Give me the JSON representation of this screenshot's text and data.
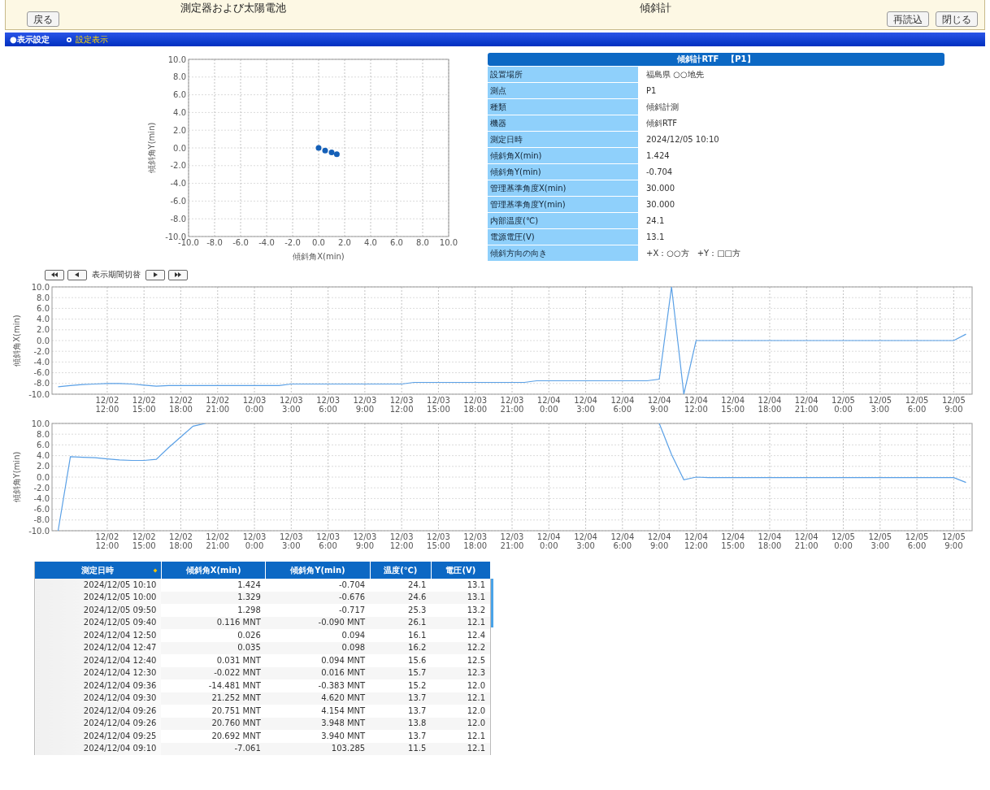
{
  "header": {
    "back_button": "戻る",
    "titles": [
      "測定器および太陽電池",
      "傾斜計"
    ],
    "buttons": [
      "再読込",
      "閉じる"
    ]
  },
  "nav_bar": {
    "section_title": "●表示設定",
    "link": "設定表示"
  },
  "scatter": {
    "chart_data": {
      "type": "scatter",
      "grid": true,
      "xlabel": "傾斜角X(min)",
      "ylabel": "傾斜角Y(min)",
      "xlim": [
        -10,
        10
      ],
      "ylim": [
        -10,
        10
      ],
      "xticks": [
        {
          "value": -10,
          "label": "-10.0"
        },
        {
          "value": -8,
          "label": "-8.0"
        },
        {
          "value": -6,
          "label": "-6.0"
        },
        {
          "value": -4,
          "label": "-4.0"
        },
        {
          "value": -2,
          "label": "-2.0"
        },
        {
          "value": 0,
          "label": "0.0"
        },
        {
          "value": 2,
          "label": "2.0"
        },
        {
          "value": 4,
          "label": "4.0"
        },
        {
          "value": 6,
          "label": "6.0"
        },
        {
          "value": 8,
          "label": "8.0"
        },
        {
          "value": 10,
          "label": "10.0"
        }
      ],
      "yticks": [
        {
          "value": 10,
          "label": "10.0"
        },
        {
          "value": 8,
          "label": "8.0"
        },
        {
          "value": 6,
          "label": "6.0"
        },
        {
          "value": 4,
          "label": "4.0"
        },
        {
          "value": 2,
          "label": "2.0"
        },
        {
          "value": 0,
          "label": "0.0"
        },
        {
          "value": -2,
          "label": "-2.0"
        },
        {
          "value": -4,
          "label": "-4.0"
        },
        {
          "value": -6,
          "label": "-6.0"
        },
        {
          "value": -8,
          "label": "-8.0"
        },
        {
          "value": -10,
          "label": "-10.0"
        }
      ],
      "x": [
        0.0,
        0.5,
        1.0,
        1.4
      ],
      "series": [
        {
          "color": "#1560b8",
          "values": [
            0.0,
            -0.3,
            -0.5,
            -0.7
          ]
        }
      ]
    }
  },
  "info": {
    "title": "傾斜計RTF　【P1】",
    "rows": [
      {
        "label": "設置場所",
        "value": "福島県 ○○地先"
      },
      {
        "label": "測点",
        "value": "P1"
      },
      {
        "label": "種類",
        "value": "傾斜計測"
      },
      {
        "label": "機器",
        "value": "傾斜RTF"
      },
      {
        "label": "測定日時",
        "value": "2024/12/05 10:10"
      },
      {
        "label": "傾斜角X(min)",
        "value": "1.424"
      },
      {
        "label": "傾斜角Y(min)",
        "value": "-0.704"
      },
      {
        "label": "管理基準角度X(min)",
        "value": "30.000"
      },
      {
        "label": "管理基準角度Y(min)",
        "value": "30.000"
      },
      {
        "label": "内部温度(℃)",
        "value": "24.1"
      },
      {
        "label": "電源電圧(V)",
        "value": "13.1"
      },
      {
        "label": "傾斜方向の向き",
        "value": "+X：○○方　+Y：□□方"
      }
    ]
  },
  "period_nav": {
    "label": "表示期間切替"
  },
  "charts": [
    {
      "chart_data": {
        "type": "line",
        "grid": true,
        "ylabel": "傾斜角X(min)",
        "ylim": [
          -10,
          10
        ],
        "categories": [
          null,
          null,
          null,
          null,
          "12/02 12:00",
          null,
          null,
          "12/02 15:00",
          null,
          null,
          "12/02 18:00",
          null,
          null,
          "12/02 21:00",
          null,
          null,
          "12/03 0:00",
          null,
          null,
          "12/03 3:00",
          null,
          null,
          "12/03 6:00",
          null,
          null,
          "12/03 9:00",
          null,
          null,
          "12/03 12:00",
          null,
          null,
          "12/03 15:00",
          null,
          null,
          "12/03 18:00",
          null,
          null,
          "12/03 21:00",
          null,
          null,
          "12/04 0:00",
          null,
          null,
          "12/04 3:00",
          null,
          null,
          "12/04 6:00",
          null,
          null,
          "12/04 9:00",
          null,
          null,
          "12/04 12:00",
          null,
          null,
          "12/04 15:00",
          null,
          null,
          "12/04 18:00",
          null,
          null,
          "12/04 21:00",
          null,
          null,
          "12/05 0:00",
          null,
          null,
          "12/05 3:00",
          null,
          null,
          "12/05 6:00",
          null,
          null,
          "12/05 9:00",
          null
        ],
        "yticks": [
          {
            "value": 10,
            "label": "10.0"
          },
          {
            "value": 8,
            "label": "8.0"
          },
          {
            "value": 6,
            "label": "6.0"
          },
          {
            "value": 4,
            "label": "4.0"
          },
          {
            "value": 2,
            "label": "2.0"
          },
          {
            "value": 0,
            "label": "0.0"
          },
          {
            "value": -2,
            "label": "-2.0"
          },
          {
            "value": -4,
            "label": "-4.0"
          },
          {
            "value": -6,
            "label": "-6.0"
          },
          {
            "value": -8,
            "label": "-8.0"
          },
          {
            "value": -10,
            "label": "-10.0"
          }
        ],
        "series": [
          {
            "color": "#5aa0e6",
            "values": [
              -8.6,
              -8.4,
              -8.2,
              -8.1,
              -8.0,
              -8.0,
              -8.1,
              -8.3,
              -8.5,
              -8.4,
              -8.4,
              -8.4,
              -8.4,
              -8.4,
              -8.4,
              -8.4,
              -8.4,
              -8.4,
              -8.4,
              -8.1,
              -8.1,
              -8.1,
              -8.1,
              -8.1,
              -8.1,
              -8.1,
              -8.1,
              -8.1,
              -8.1,
              -7.8,
              -7.8,
              -7.8,
              -7.8,
              -7.8,
              -7.8,
              -7.8,
              -7.8,
              -7.8,
              -7.8,
              -7.5,
              -7.5,
              -7.5,
              -7.5,
              -7.5,
              -7.5,
              -7.5,
              -7.5,
              -7.5,
              -7.5,
              -7.2,
              10,
              -10,
              0,
              0,
              0,
              0,
              0,
              0,
              0,
              0,
              0,
              0,
              0,
              0,
              0,
              0,
              0,
              0,
              0,
              0,
              0,
              0,
              0,
              0,
              1.2
            ]
          }
        ]
      }
    },
    {
      "chart_data": {
        "type": "line",
        "grid": true,
        "ylabel": "傾斜角Y(min)",
        "ylim": [
          -10,
          10
        ],
        "categories": [
          null,
          null,
          null,
          null,
          "12/02 12:00",
          null,
          null,
          "12/02 15:00",
          null,
          null,
          "12/02 18:00",
          null,
          null,
          "12/02 21:00",
          null,
          null,
          "12/03 0:00",
          null,
          null,
          "12/03 3:00",
          null,
          null,
          "12/03 6:00",
          null,
          null,
          "12/03 9:00",
          null,
          null,
          "12/03 12:00",
          null,
          null,
          "12/03 15:00",
          null,
          null,
          "12/03 18:00",
          null,
          null,
          "12/03 21:00",
          null,
          null,
          "12/04 0:00",
          null,
          null,
          "12/04 3:00",
          null,
          null,
          "12/04 6:00",
          null,
          null,
          "12/04 9:00",
          null,
          null,
          "12/04 12:00",
          null,
          null,
          "12/04 15:00",
          null,
          null,
          "12/04 18:00",
          null,
          null,
          "12/04 21:00",
          null,
          null,
          "12/05 0:00",
          null,
          null,
          "12/05 3:00",
          null,
          null,
          "12/05 6:00",
          null,
          null,
          "12/05 9:00",
          null
        ],
        "yticks": [
          {
            "value": 10,
            "label": "10.0"
          },
          {
            "value": 8,
            "label": "8.0"
          },
          {
            "value": 6,
            "label": "6.0"
          },
          {
            "value": 4,
            "label": "4.0"
          },
          {
            "value": 2,
            "label": "2.0"
          },
          {
            "value": 0,
            "label": "0.0"
          },
          {
            "value": -2,
            "label": "-2.0"
          },
          {
            "value": -4,
            "label": "-4.0"
          },
          {
            "value": -6,
            "label": "-6.0"
          },
          {
            "value": -8,
            "label": "-8.0"
          },
          {
            "value": -10,
            "label": "-10.0"
          }
        ],
        "series": [
          {
            "color": "#5aa0e6",
            "values": [
              -10,
              3.8,
              3.7,
              3.6,
              3.4,
              3.2,
              3.1,
              3.1,
              3.3,
              5.5,
              7.5,
              9.5,
              10,
              null,
              null,
              null,
              null,
              null,
              null,
              null,
              null,
              null,
              null,
              null,
              null,
              null,
              null,
              null,
              null,
              null,
              null,
              null,
              null,
              null,
              null,
              null,
              null,
              null,
              null,
              null,
              null,
              null,
              null,
              null,
              null,
              null,
              null,
              null,
              null,
              10,
              4.2,
              -0.5,
              0,
              -0.1,
              -0.1,
              -0.1,
              -0.1,
              -0.1,
              -0.1,
              -0.1,
              -0.1,
              -0.1,
              -0.1,
              -0.1,
              -0.1,
              -0.1,
              -0.1,
              -0.1,
              -0.1,
              -0.1,
              -0.1,
              -0.1,
              -0.1,
              -0.1,
              -1.0
            ]
          }
        ]
      }
    }
  ],
  "table": {
    "columns": [
      "測定日時",
      "傾斜角X(min)",
      "傾斜角Y(min)",
      "温度(℃)",
      "電圧(V)"
    ],
    "rows": [
      [
        "2024/12/05 10:10",
        "1.424",
        "-0.704",
        "24.1",
        "13.1"
      ],
      [
        "2024/12/05 10:00",
        "1.329",
        "-0.676",
        "24.6",
        "13.1"
      ],
      [
        "2024/12/05 09:50",
        "1.298",
        "-0.717",
        "25.3",
        "13.2"
      ],
      [
        "2024/12/05 09:40",
        "0.116 MNT",
        "-0.090 MNT",
        "26.1",
        "12.1"
      ],
      [
        "2024/12/04 12:50",
        "0.026",
        "0.094",
        "16.1",
        "12.4"
      ],
      [
        "2024/12/04 12:47",
        "0.035",
        "0.098",
        "16.2",
        "12.2"
      ],
      [
        "2024/12/04 12:40",
        "0.031 MNT",
        "0.094 MNT",
        "15.6",
        "12.5"
      ],
      [
        "2024/12/04 12:30",
        "-0.022 MNT",
        "0.016 MNT",
        "15.7",
        "12.3"
      ],
      [
        "2024/12/04 09:36",
        "-14.481 MNT",
        "-0.383 MNT",
        "15.2",
        "12.0"
      ],
      [
        "2024/12/04 09:30",
        "21.252 MNT",
        "4.620 MNT",
        "13.7",
        "12.1"
      ],
      [
        "2024/12/04 09:26",
        "20.751 MNT",
        "4.154 MNT",
        "13.7",
        "12.0"
      ],
      [
        "2024/12/04 09:26",
        "20.760 MNT",
        "3.948 MNT",
        "13.8",
        "12.0"
      ],
      [
        "2024/12/04 09:25",
        "20.692 MNT",
        "3.940 MNT",
        "13.7",
        "12.1"
      ],
      [
        "2024/12/04 09:10",
        "-7.061",
        "103.285",
        "11.5",
        "12.1"
      ]
    ]
  }
}
